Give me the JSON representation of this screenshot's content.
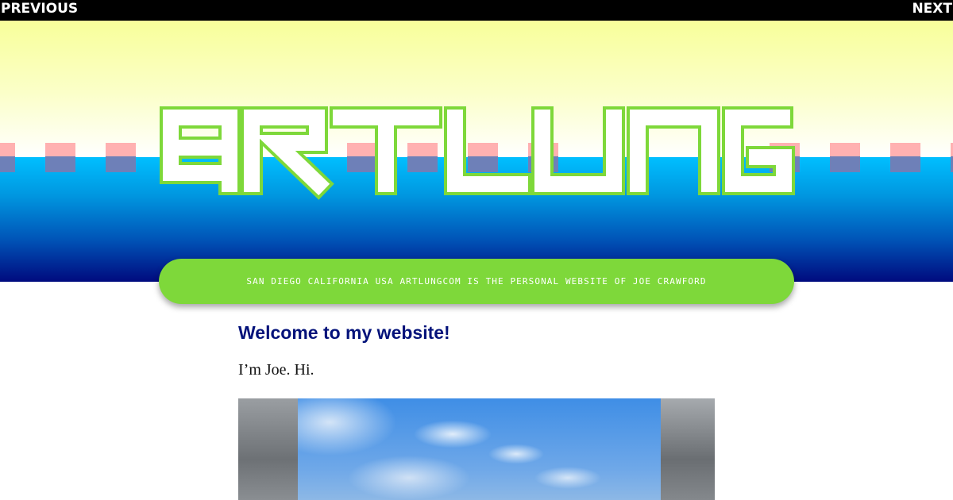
{
  "nav": {
    "previous_label": "PREVIOUS",
    "next_label": "NEXT"
  },
  "header": {
    "logo_text": "ARTLUNG",
    "tagline": "SAN DIEGO CALIFORNIA USA  ARTLUNGCOM IS THE PERSONAL WEBSITE OF JOE CRAWFORD"
  },
  "post": {
    "title": "Welcome to my website!",
    "intro": "I’m Joe. Hi."
  },
  "colors": {
    "accent_green": "#7ed83a",
    "heading_navy": "#03127a",
    "sky_blue": "#00bfff",
    "pale_yellow": "#f8ff9a"
  }
}
